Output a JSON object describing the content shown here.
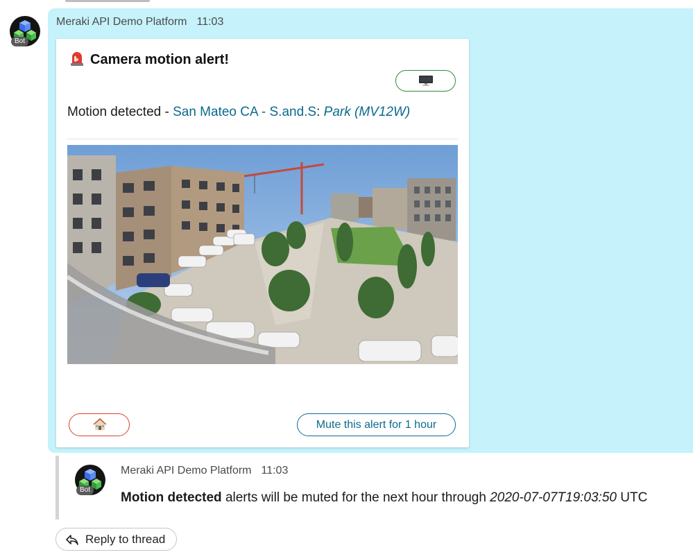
{
  "message": {
    "sender": "Meraki API Demo Platform",
    "time": "11:03",
    "avatar_badge": "Bot",
    "avatar_icon": "cube-cluster-icon",
    "card": {
      "title": "Camera motion alert!",
      "title_icon": "siren-icon",
      "top_action_icon": "monitor-icon",
      "motion_prefix": "Motion detected - ",
      "location": "San Mateo  CA - S.and.S",
      "location_sep": ": ",
      "camera": "Park (MV12W)",
      "snapshot_alt": "camera snapshot",
      "home_action_icon": "house-icon",
      "mute_label": "Mute this alert for 1 hour"
    }
  },
  "thread_reply": {
    "sender": "Meraki API Demo Platform",
    "time": "11:03",
    "avatar_badge": "Bot",
    "bold_text": "Motion detected",
    "text_middle": " alerts will be muted for the next hour through ",
    "timestamp": "2020-07-07T19:03:50",
    "suffix": " UTC"
  },
  "reply_to_thread_label": "Reply to thread",
  "colors": {
    "highlight": "#c5f2fb",
    "link": "#0b6a8e",
    "positive": "#2e8b3a",
    "destructive": "#d9412e"
  }
}
